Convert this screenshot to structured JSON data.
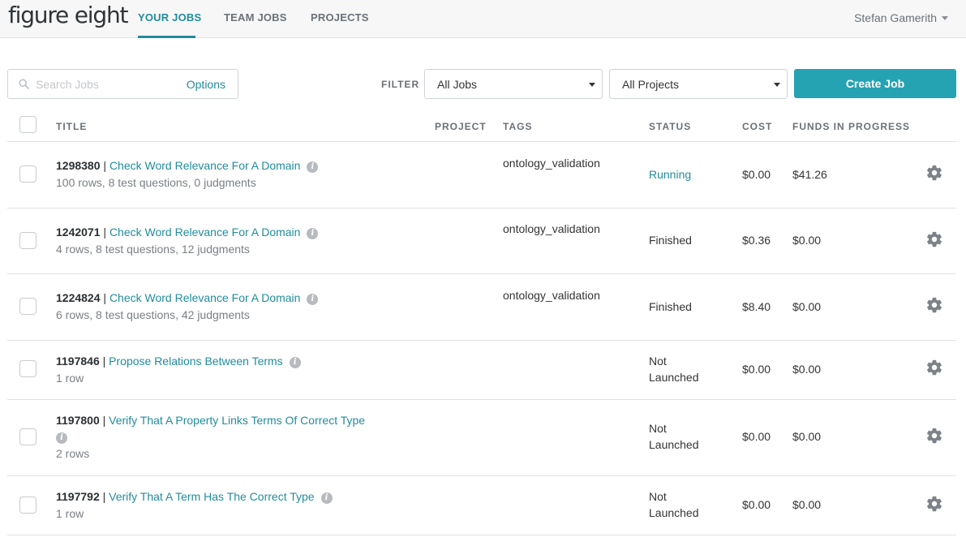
{
  "brand": {
    "logo_text": "figure eight"
  },
  "nav": {
    "tabs": [
      {
        "label": "YOUR JOBS",
        "active": true
      },
      {
        "label": "TEAM JOBS",
        "active": false
      },
      {
        "label": "PROJECTS",
        "active": false
      }
    ],
    "user_name": "Stefan Gamerith"
  },
  "toolbar": {
    "search_placeholder": "Search Jobs",
    "options_label": "Options",
    "filter_label": "FILTER",
    "jobs_filter_value": "All Jobs",
    "projects_filter_value": "All Projects",
    "create_button_label": "Create Job"
  },
  "table": {
    "headers": {
      "title": "TITLE",
      "project": "PROJECT",
      "tags": "TAGS",
      "status": "STATUS",
      "cost": "COST",
      "funds": "FUNDS IN PROGRESS"
    },
    "rows": [
      {
        "id": "1298380",
        "sep": "|",
        "title": "Check Word Relevance For A Domain",
        "details": "100 rows, 8 test questions, 0 judgments",
        "tags": "ontology_validation",
        "status_line1": "Running",
        "status_line2": "",
        "cost": "$0.00",
        "funds": "$41.26"
      },
      {
        "id": "1242071",
        "sep": "|",
        "title": "Check Word Relevance For A Domain",
        "details": "4 rows, 8 test questions, 12 judgments",
        "tags": "ontology_validation",
        "status_line1": "Finished",
        "status_line2": "",
        "cost": "$0.36",
        "funds": "$0.00"
      },
      {
        "id": "1224824",
        "sep": "|",
        "title": "Check Word Relevance For A Domain",
        "details": "6 rows, 8 test questions, 42 judgments",
        "tags": "ontology_validation",
        "status_line1": "Finished",
        "status_line2": "",
        "cost": "$8.40",
        "funds": "$0.00"
      },
      {
        "id": "1197846",
        "sep": "|",
        "title": "Propose Relations Between Terms",
        "details": "1 row",
        "tags": "",
        "status_line1": "Not",
        "status_line2": "Launched",
        "cost": "$0.00",
        "funds": "$0.00"
      },
      {
        "id": "1197800",
        "sep": "|",
        "title": "Verify That A Property Links Terms Of Correct Type",
        "details": "2 rows",
        "tags": "",
        "status_line1": "Not",
        "status_line2": "Launched",
        "cost": "$0.00",
        "funds": "$0.00"
      },
      {
        "id": "1197792",
        "sep": "|",
        "title": "Verify That A Term Has The Correct Type",
        "details": "1 row",
        "tags": "",
        "status_line1": "Not",
        "status_line2": "Launched",
        "cost": "$0.00",
        "funds": "$0.00"
      }
    ]
  },
  "icons": {
    "search": "search-icon",
    "info": "info-icon",
    "settings": "gear-icon",
    "dropdown": "chevron-down-icon"
  },
  "colors": {
    "accent": "#218c9c",
    "button": "#26a3b3"
  }
}
